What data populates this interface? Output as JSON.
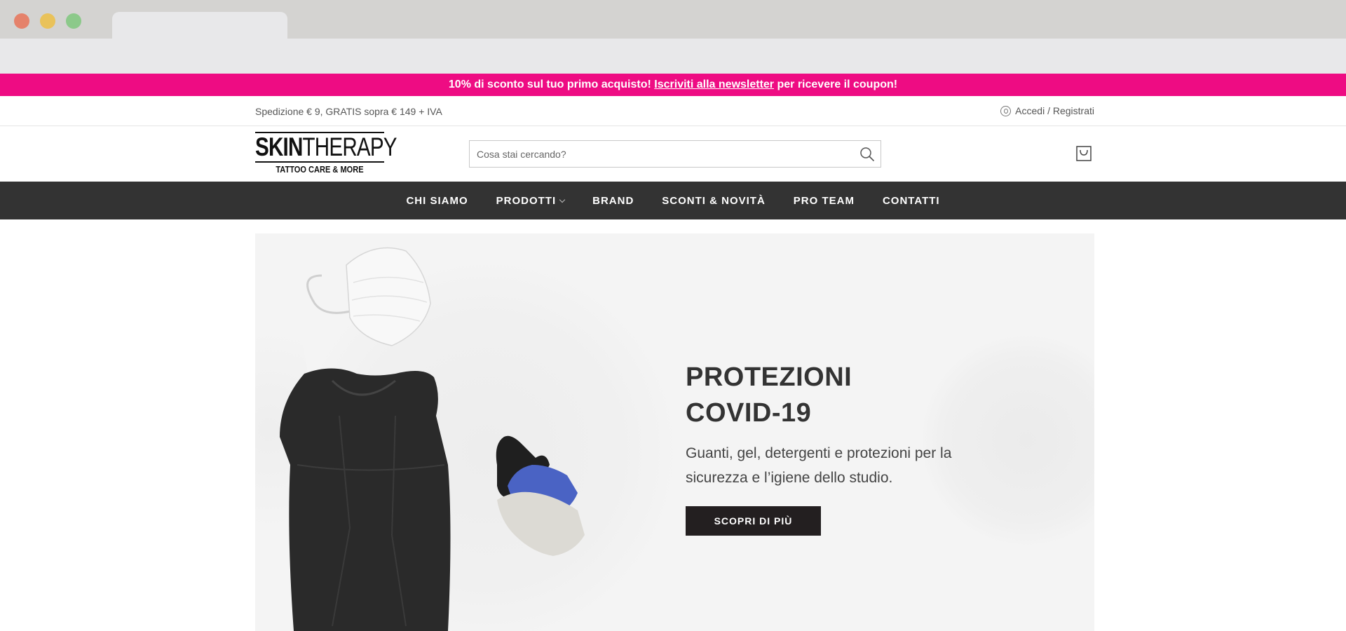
{
  "promo": {
    "text_before": "10% di sconto sul tuo primo acquisto!",
    "link": "Iscriviti alla newsletter",
    "text_after": "per ricevere il coupon!",
    "color": "#ee0c83"
  },
  "topbar": {
    "shipping": "Spedizione € 9, GRATIS sopra € 149 + IVA",
    "login": "Accedi / Registrati"
  },
  "header": {
    "logo_main_bold": "SKIN",
    "logo_main_rest": "THERAPY",
    "logo_sub": "TATTOO CARE & MORE",
    "search_placeholder": "Cosa stai cercando?"
  },
  "nav": {
    "items": [
      {
        "label": "CHI SIAMO"
      },
      {
        "label": "PRODOTTI"
      },
      {
        "label": "BRAND"
      },
      {
        "label": "SCONTI & NOVITÀ"
      },
      {
        "label": "PRO TEAM"
      },
      {
        "label": "CONTATTI"
      }
    ],
    "background": "#333333"
  },
  "hero": {
    "title_line1": "PROTEZIONI",
    "title_line2": "COVID-19",
    "description": "Guanti, gel, detergenti e protezioni per la sicurezza e l’igiene dello studio.",
    "button": "SCOPRI DI PIÙ"
  },
  "icons": {
    "search": "search-icon",
    "cart": "shopping-bag-icon",
    "user": "user-icon"
  }
}
